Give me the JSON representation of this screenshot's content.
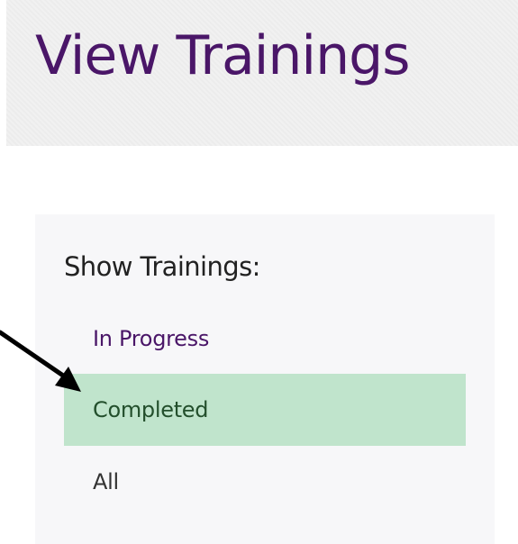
{
  "page": {
    "title": "View Trainings"
  },
  "filter_panel": {
    "heading": "Show Trainings:",
    "options": [
      {
        "label": "In Progress",
        "selected": false
      },
      {
        "label": "Completed",
        "selected": true
      },
      {
        "label": "All",
        "selected": false
      }
    ]
  },
  "colors": {
    "title_text": "#4a1668",
    "selected_background": "#c0e4cc",
    "selected_text": "#234f2c",
    "panel_background": "#f7f7f9"
  },
  "icons": {
    "annotation": "arrow-icon"
  }
}
